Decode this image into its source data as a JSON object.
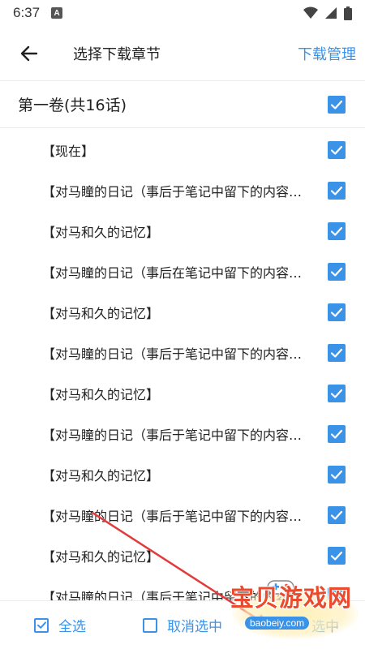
{
  "status": {
    "time": "6:37",
    "indicator": "A",
    "icons": [
      "wifi-icon",
      "signal-icon",
      "battery-icon"
    ]
  },
  "header": {
    "back_icon": "arrow-left-icon",
    "title": "选择下载章节",
    "manage": "下载管理"
  },
  "volume": {
    "title": "第一卷(共16话)",
    "checked": true
  },
  "chapters": [
    {
      "title": "【现在】",
      "checked": true
    },
    {
      "title": "【对马瞳的日记（事后于笔记中留下的内容…",
      "checked": true
    },
    {
      "title": "【对马和久的记忆】",
      "checked": true
    },
    {
      "title": "【对马瞳的日记（事后在笔记中留下的内容…",
      "checked": true
    },
    {
      "title": "【对马和久的记忆】",
      "checked": true
    },
    {
      "title": "【对马瞳的日记（事后于笔记中留下的内容…",
      "checked": true
    },
    {
      "title": "【对马和久的记忆】",
      "checked": true
    },
    {
      "title": "【对马瞳的日记（事后于笔记中留下的内容…",
      "checked": true
    },
    {
      "title": "【对马和久的记忆】",
      "checked": true
    },
    {
      "title": "【对马瞳的日记（事后于笔记中留下的内容…",
      "checked": true
    },
    {
      "title": "【对马和久的记忆】",
      "checked": true
    },
    {
      "title": "【对马瞳的日记（事后于笔记中留下的内容…",
      "checked": true
    }
  ],
  "bottom": {
    "select_all": "全选",
    "deselect": "取消选中",
    "download_selected": "选中"
  },
  "watermark": {
    "text": "宝贝游戏网",
    "url": "baobeiy.com"
  },
  "colors": {
    "accent": "#3b93e8",
    "text": "#222222",
    "divider": "#ececec",
    "arrow": "#e23b3b"
  }
}
